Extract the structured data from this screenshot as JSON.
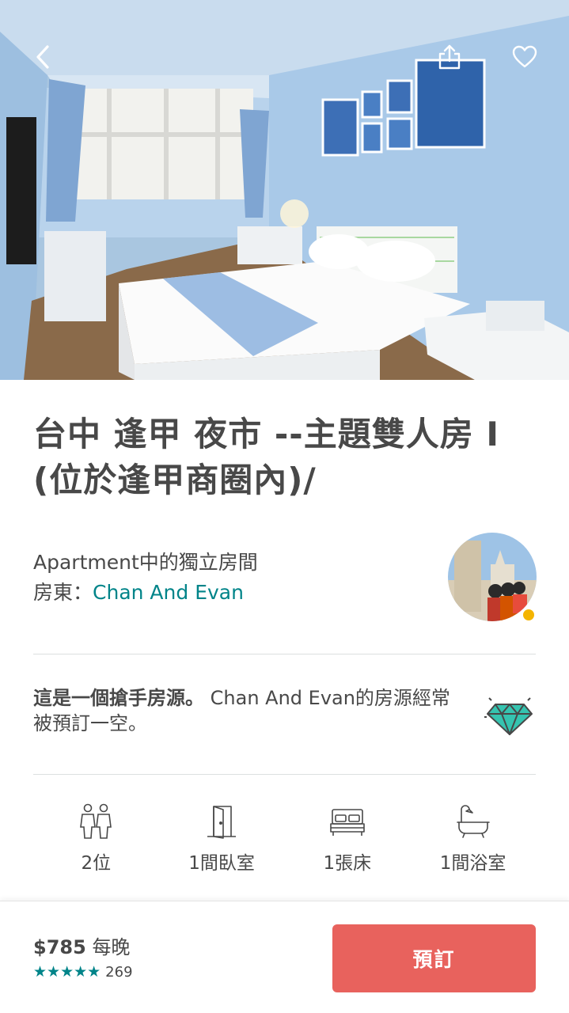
{
  "listing": {
    "title": "台中 逢甲 夜市 --主題雙人房 I (位於逢甲商圈內)/",
    "room_type": "Apartment中的獨立房間",
    "host_prefix": "房東：",
    "host_name": "Chan And Evan"
  },
  "rare_find": {
    "bold": "這是一個搶手房源。",
    "text": "Chan And Evan的房源經常被預訂一空。",
    "icon": "diamond-icon"
  },
  "amenities": [
    {
      "icon": "guests-icon",
      "label": "2位"
    },
    {
      "icon": "door-icon",
      "label": "1間臥室"
    },
    {
      "icon": "bed-icon",
      "label": "1張床"
    },
    {
      "icon": "bathtub-icon",
      "label": "1間浴室"
    }
  ],
  "booking": {
    "price": "$785",
    "per_night": "每晚",
    "stars": "★★★★★",
    "review_count": "269",
    "book_label": "預訂"
  },
  "colors": {
    "accent_teal": "#008489",
    "book_button": "#e8625d",
    "text": "#484848"
  }
}
